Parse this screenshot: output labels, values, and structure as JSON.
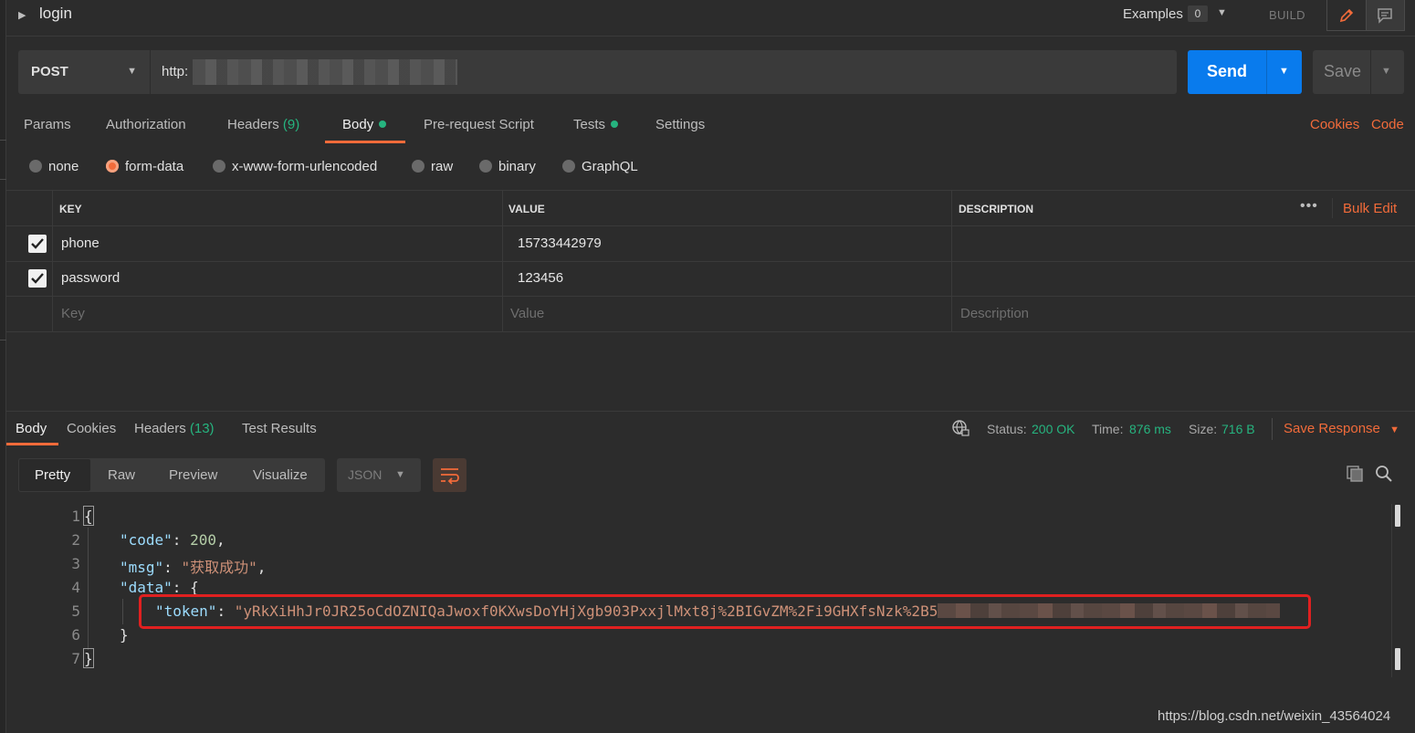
{
  "request": {
    "name": "login",
    "examples_label": "Examples",
    "examples_count": "0",
    "build_label": "BUILD",
    "method": "POST",
    "url": "http:",
    "send_label": "Send",
    "save_label": "Save"
  },
  "request_tabs": {
    "params": "Params",
    "authorization": "Authorization",
    "headers": "Headers",
    "headers_count": "(9)",
    "body": "Body",
    "pre_request": "Pre-request Script",
    "tests": "Tests",
    "settings": "Settings",
    "cookies": "Cookies",
    "code": "Code"
  },
  "body_types": [
    "none",
    "form-data",
    "x-www-form-urlencoded",
    "raw",
    "binary",
    "GraphQL"
  ],
  "params_table": {
    "headers": {
      "key": "KEY",
      "value": "VALUE",
      "description": "DESCRIPTION"
    },
    "bulk_edit": "Bulk Edit",
    "rows": [
      {
        "key": "phone",
        "value": "15733442979",
        "checked": true
      },
      {
        "key": "password",
        "value": "123456",
        "checked": true
      }
    ],
    "placeholder": {
      "key": "Key",
      "value": "Value",
      "description": "Description"
    }
  },
  "response": {
    "tabs": {
      "body": "Body",
      "cookies": "Cookies",
      "headers": "Headers",
      "headers_count": "(13)",
      "test_results": "Test Results"
    },
    "status_label": "Status:",
    "status_value": "200 OK",
    "time_label": "Time:",
    "time_value": "876 ms",
    "size_label": "Size:",
    "size_value": "716 B",
    "save_response": "Save Response",
    "view_modes": [
      "Pretty",
      "Raw",
      "Preview",
      "Visualize"
    ],
    "format": "JSON",
    "json": {
      "line_numbers": [
        "1",
        "2",
        "3",
        "4",
        "5",
        "6",
        "7"
      ],
      "open_brace": "{",
      "close_brace": "}",
      "code_key": "\"code\"",
      "code_value": "200",
      "msg_key": "\"msg\"",
      "msg_value": "\"获取成功\"",
      "data_key": "\"data\"",
      "data_open": "{",
      "token_key": "\"token\"",
      "token_value": "\"yRkXiHhJr0JR25oCdOZNIQaJwoxf0KXwsDoYHjXgb903PxxjlMxt8j%2BIGvZM%2Fi9GHXfsNzk%2B5",
      "data_close": "}"
    }
  },
  "watermark": "https://blog.csdn.net/weixin_43564024",
  "colors": {
    "accent": "#f26b3a",
    "send": "#097bed",
    "success": "#26b47f",
    "highlight_box": "#e02020"
  }
}
